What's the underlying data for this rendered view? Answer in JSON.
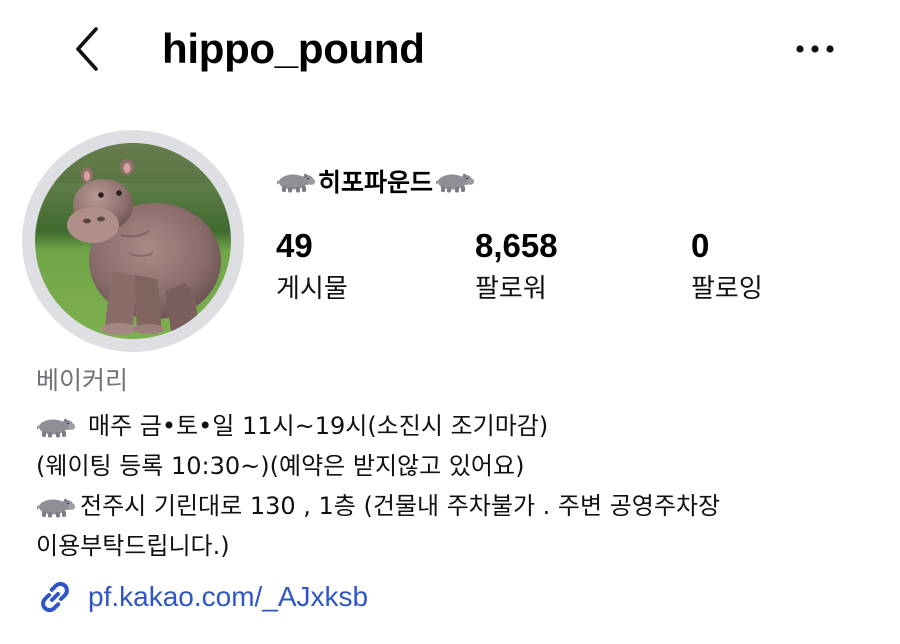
{
  "header": {
    "username": "hippo_pound",
    "back_icon": "chevron-left-icon",
    "more_icon": "more-horizontal-icon"
  },
  "profile": {
    "display_name": "히포파운드",
    "name_emoji": "hippopotamus",
    "stats": [
      {
        "value": "49",
        "label": "게시물"
      },
      {
        "value": "8,658",
        "label": "팔로워"
      },
      {
        "value": "0",
        "label": "팔로잉"
      }
    ]
  },
  "bio": {
    "category": "베이커리",
    "lines": [
      "매주 금•토•일 11시~19시(소진시 조기마감)",
      "(웨이팅 등록 10:30~)(예약은 받지않고 있어요)",
      "전주시 기린대로 130 , 1층 (건물내 주차불가 . 주변 공영주차장",
      "이용부탁드립니다.)"
    ],
    "link": "pf.kakao.com/_AJxksb"
  },
  "colors": {
    "link": "#2f56c6",
    "category_text": "#6f7378",
    "avatar_ring": "#dedfe3"
  }
}
